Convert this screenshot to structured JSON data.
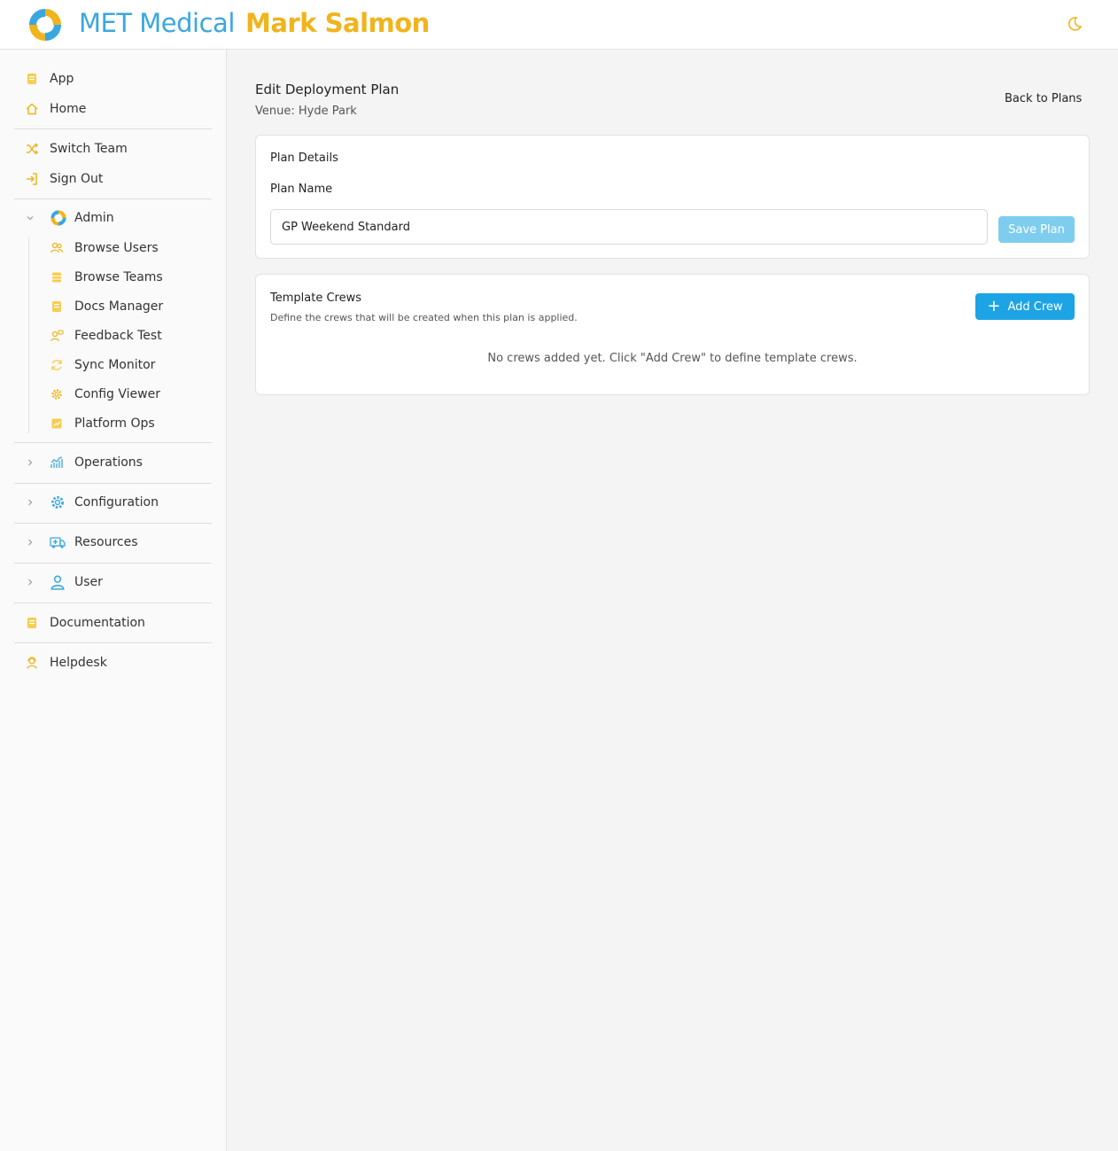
{
  "header": {
    "brand": "MET Medical",
    "user_name": "Mark Salmon",
    "theme_toggle_icon": "moon-icon"
  },
  "colors": {
    "brand_blue": "#3aa7df",
    "brand_yellow": "#f0b41c",
    "primary_button": "#1da4e4",
    "disabled_button": "#7fcdee"
  },
  "sidebar": {
    "app": "App",
    "home": "Home",
    "switch_team": "Switch Team",
    "sign_out": "Sign Out",
    "admin": "Admin",
    "admin_items": [
      "Browse Users",
      "Browse Teams",
      "Docs Manager",
      "Feedback Test",
      "Sync Monitor",
      "Config Viewer",
      "Platform Ops"
    ],
    "operations": "Operations",
    "configuration": "Configuration",
    "resources": "Resources",
    "user": "User",
    "documentation": "Documentation",
    "helpdesk": "Helpdesk"
  },
  "main": {
    "title": "Edit Deployment Plan",
    "venue": "Venue: Hyde Park",
    "back_link": "Back to Plans",
    "plan_details": {
      "title": "Plan Details",
      "field_label": "Plan Name",
      "field_value": "GP Weekend Standard",
      "save_label": "Save Plan"
    },
    "template_crews": {
      "title": "Template Crews",
      "subtitle": "Define the crews that will be created when this plan is applied.",
      "add_label": "Add Crew",
      "empty_message": "No crews added yet. Click \"Add Crew\" to define template crews."
    }
  }
}
